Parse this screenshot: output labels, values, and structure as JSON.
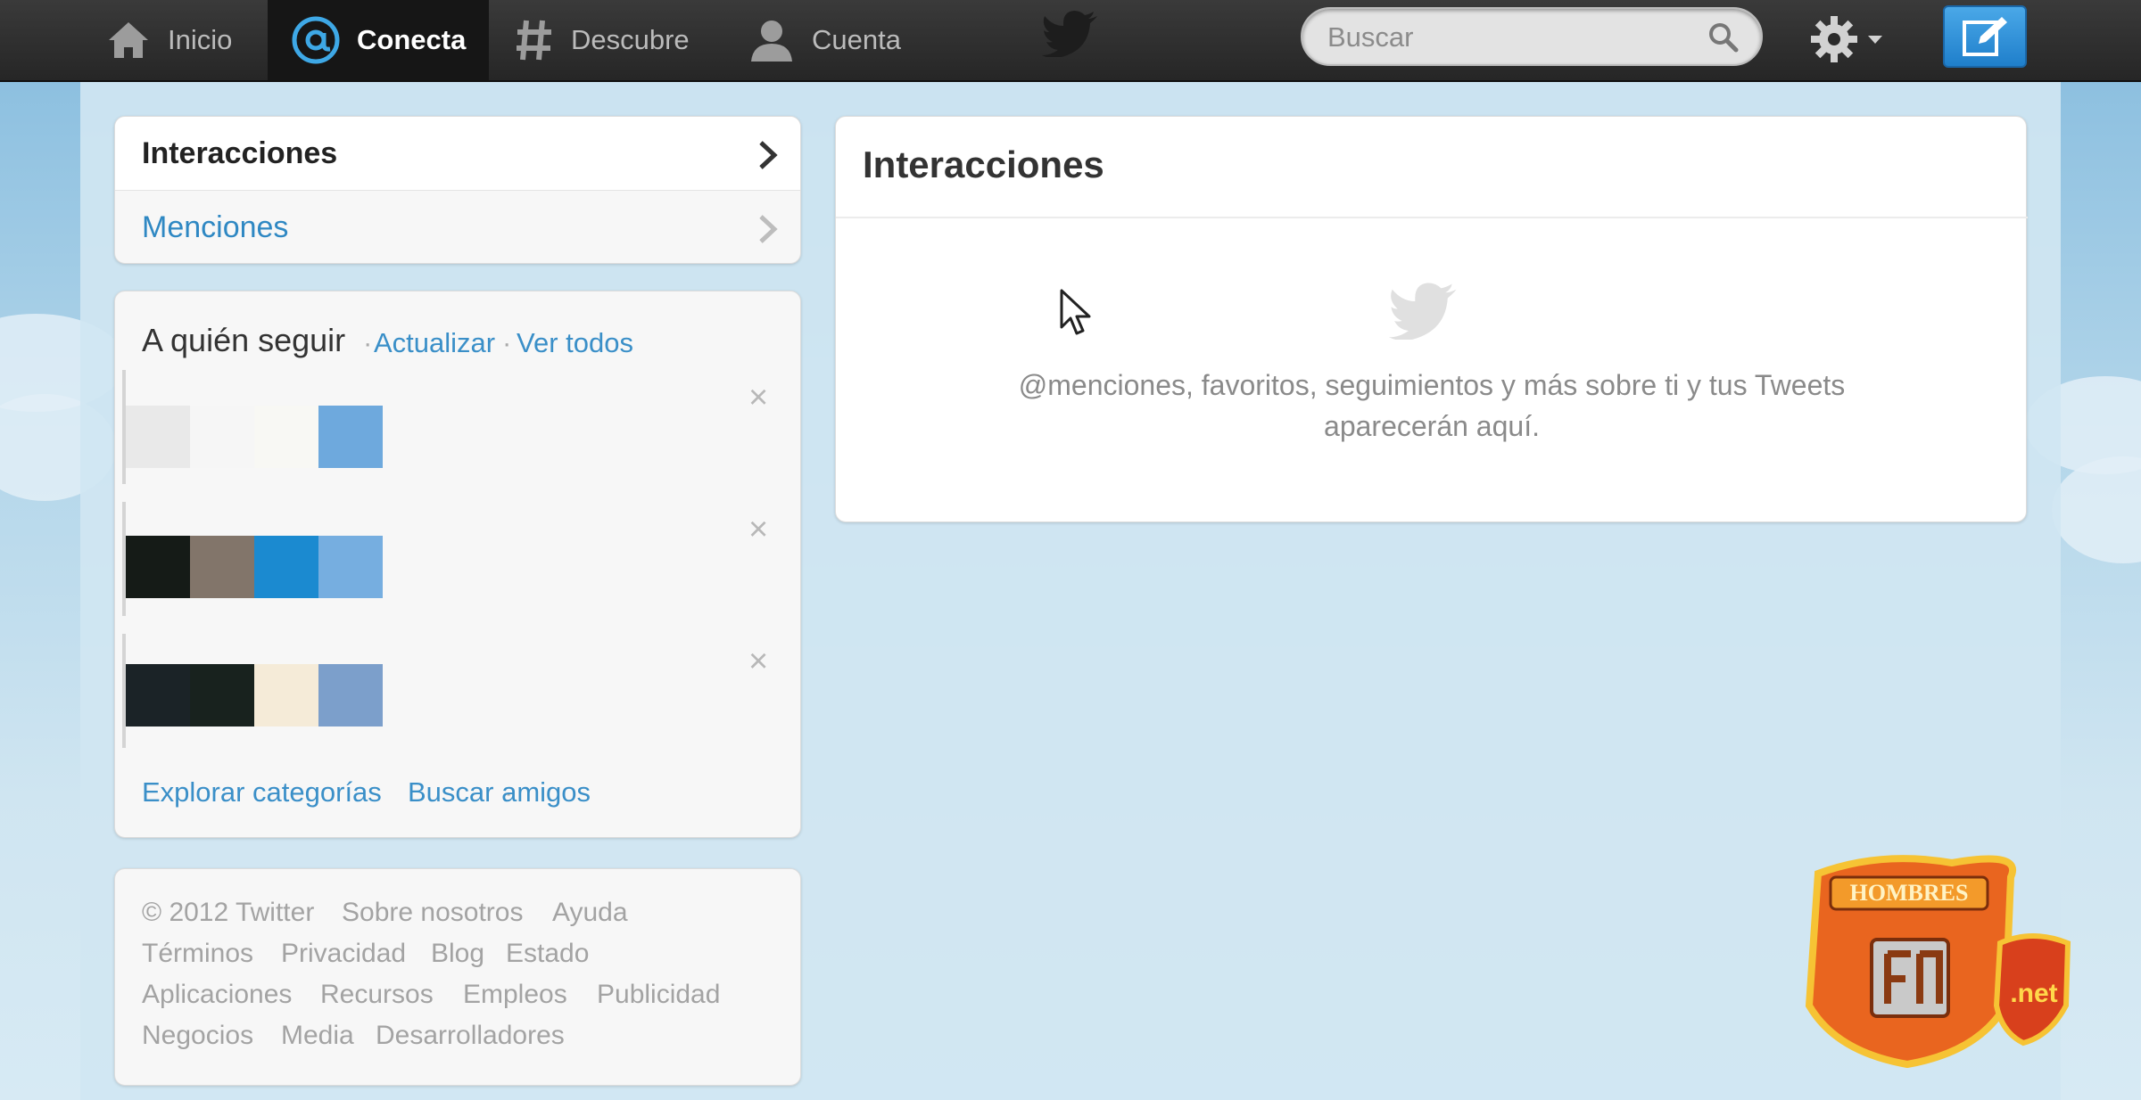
{
  "nav": {
    "items": [
      {
        "label": "Inicio",
        "icon": "home-icon"
      },
      {
        "label": "Conecta",
        "icon": "at-icon",
        "active": true
      },
      {
        "label": "Descubre",
        "icon": "hashtag-icon"
      },
      {
        "label": "Cuenta",
        "icon": "user-icon"
      }
    ],
    "search_placeholder": "Buscar"
  },
  "sidebar": {
    "menu": [
      {
        "label": "Interacciones",
        "selected": true
      },
      {
        "label": "Menciones"
      }
    ],
    "who_to_follow": {
      "title": "A quién seguir",
      "refresh": "Actualizar",
      "view_all": "Ver todos",
      "separator": "·",
      "explore": "Explorar categorías",
      "find_friends": "Buscar amigos"
    },
    "footer": {
      "links": [
        "© 2012 Twitter",
        "Sobre nosotros",
        "Ayuda",
        "Términos",
        "Privacidad",
        "Blog",
        "Estado",
        "Aplicaciones",
        "Recursos",
        "Empleos",
        "Publicidad",
        "Negocios",
        "Media",
        "Desarrolladores"
      ]
    }
  },
  "main": {
    "title": "Interacciones",
    "empty_line1": "@menciones, favoritos, seguimientos y más sobre ti y tus Tweets",
    "empty_line2": "aparecerán aquí."
  },
  "watermark": {
    "top": "HOMBRES",
    "bottom": ".net"
  },
  "colors": {
    "accent": "#2f88c3",
    "topbar": "#2b2b2b",
    "compose": "#2a8bd6"
  }
}
